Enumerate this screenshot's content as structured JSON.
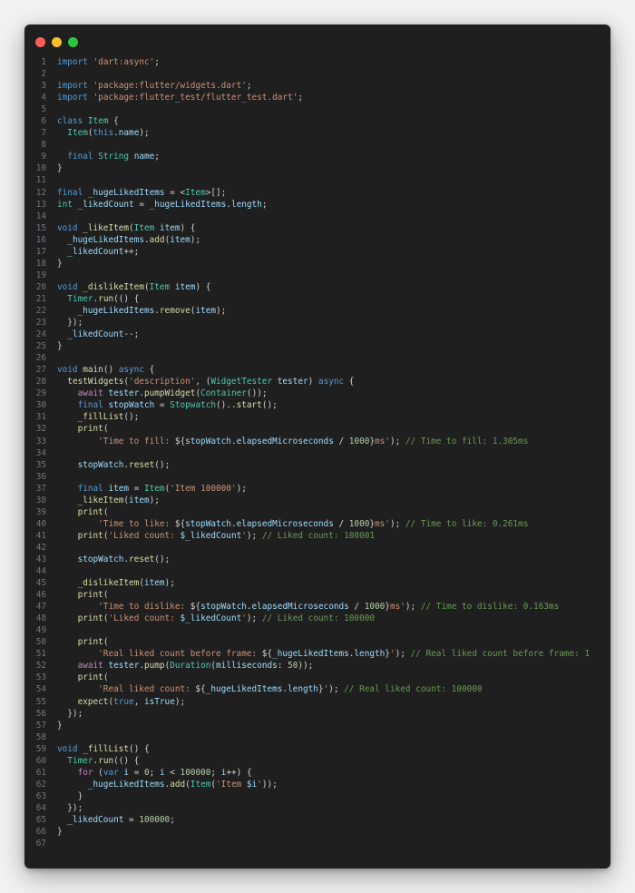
{
  "window": {
    "controls": [
      "close",
      "minimize",
      "maximize"
    ]
  },
  "editor": {
    "language": "dart",
    "lines": [
      [
        [
          "kw",
          "import"
        ],
        [
          "p",
          " "
        ],
        [
          "str",
          "'dart:async'"
        ],
        [
          "p",
          ";"
        ]
      ],
      [],
      [
        [
          "kw",
          "import"
        ],
        [
          "p",
          " "
        ],
        [
          "str",
          "'package:flutter/widgets.dart'"
        ],
        [
          "p",
          ";"
        ]
      ],
      [
        [
          "kw",
          "import"
        ],
        [
          "p",
          " "
        ],
        [
          "str",
          "'package:flutter_test/flutter_test.dart'"
        ],
        [
          "p",
          ";"
        ]
      ],
      [],
      [
        [
          "kw",
          "class"
        ],
        [
          "p",
          " "
        ],
        [
          "ty",
          "Item"
        ],
        [
          "p",
          " {"
        ]
      ],
      [
        [
          "p",
          "  "
        ],
        [
          "ty",
          "Item"
        ],
        [
          "p",
          "("
        ],
        [
          "kw",
          "this"
        ],
        [
          "p",
          "."
        ],
        [
          "var",
          "name"
        ],
        [
          "p",
          ");"
        ]
      ],
      [],
      [
        [
          "p",
          "  "
        ],
        [
          "kw",
          "final"
        ],
        [
          "p",
          " "
        ],
        [
          "ty",
          "String"
        ],
        [
          "p",
          " "
        ],
        [
          "var",
          "name"
        ],
        [
          "p",
          ";"
        ]
      ],
      [
        [
          "p",
          "}"
        ]
      ],
      [],
      [
        [
          "kw",
          "final"
        ],
        [
          "p",
          " "
        ],
        [
          "var",
          "_hugeLikedItems"
        ],
        [
          "p",
          " = <"
        ],
        [
          "ty",
          "Item"
        ],
        [
          "p",
          ">[];"
        ]
      ],
      [
        [
          "ty",
          "int"
        ],
        [
          "p",
          " "
        ],
        [
          "var",
          "_likedCount"
        ],
        [
          "p",
          " = "
        ],
        [
          "var",
          "_hugeLikedItems"
        ],
        [
          "p",
          "."
        ],
        [
          "var",
          "length"
        ],
        [
          "p",
          ";"
        ]
      ],
      [],
      [
        [
          "kw",
          "void"
        ],
        [
          "p",
          " "
        ],
        [
          "fn",
          "_likeItem"
        ],
        [
          "p",
          "("
        ],
        [
          "ty",
          "Item"
        ],
        [
          "p",
          " "
        ],
        [
          "var",
          "item"
        ],
        [
          "p",
          ") {"
        ]
      ],
      [
        [
          "p",
          "  "
        ],
        [
          "var",
          "_hugeLikedItems"
        ],
        [
          "p",
          "."
        ],
        [
          "fn",
          "add"
        ],
        [
          "p",
          "("
        ],
        [
          "var",
          "item"
        ],
        [
          "p",
          ");"
        ]
      ],
      [
        [
          "p",
          "  "
        ],
        [
          "var",
          "_likedCount"
        ],
        [
          "p",
          "++;"
        ]
      ],
      [
        [
          "p",
          "}"
        ]
      ],
      [],
      [
        [
          "kw",
          "void"
        ],
        [
          "p",
          " "
        ],
        [
          "fn",
          "_dislikeItem"
        ],
        [
          "p",
          "("
        ],
        [
          "ty",
          "Item"
        ],
        [
          "p",
          " "
        ],
        [
          "var",
          "item"
        ],
        [
          "p",
          ") {"
        ]
      ],
      [
        [
          "p",
          "  "
        ],
        [
          "ty",
          "Timer"
        ],
        [
          "p",
          "."
        ],
        [
          "fn",
          "run"
        ],
        [
          "p",
          "(() {"
        ]
      ],
      [
        [
          "p",
          "    "
        ],
        [
          "var",
          "_hugeLikedItems"
        ],
        [
          "p",
          "."
        ],
        [
          "fn",
          "remove"
        ],
        [
          "p",
          "("
        ],
        [
          "var",
          "item"
        ],
        [
          "p",
          ");"
        ]
      ],
      [
        [
          "p",
          "  });"
        ]
      ],
      [
        [
          "p",
          "  "
        ],
        [
          "var",
          "_likedCount"
        ],
        [
          "p",
          "--;"
        ]
      ],
      [
        [
          "p",
          "}"
        ]
      ],
      [],
      [
        [
          "kw",
          "void"
        ],
        [
          "p",
          " "
        ],
        [
          "fn",
          "main"
        ],
        [
          "p",
          "() "
        ],
        [
          "kw",
          "async"
        ],
        [
          "p",
          " {"
        ]
      ],
      [
        [
          "p",
          "  "
        ],
        [
          "fn",
          "testWidgets"
        ],
        [
          "p",
          "("
        ],
        [
          "str",
          "'description'"
        ],
        [
          "p",
          ", ("
        ],
        [
          "ty",
          "WidgetTester"
        ],
        [
          "p",
          " "
        ],
        [
          "var",
          "tester"
        ],
        [
          "p",
          ") "
        ],
        [
          "kw",
          "async"
        ],
        [
          "p",
          " {"
        ]
      ],
      [
        [
          "p",
          "    "
        ],
        [
          "ctl",
          "await"
        ],
        [
          "p",
          " "
        ],
        [
          "var",
          "tester"
        ],
        [
          "p",
          "."
        ],
        [
          "fn",
          "pumpWidget"
        ],
        [
          "p",
          "("
        ],
        [
          "ty",
          "Container"
        ],
        [
          "p",
          "());"
        ]
      ],
      [
        [
          "p",
          "    "
        ],
        [
          "kw",
          "final"
        ],
        [
          "p",
          " "
        ],
        [
          "var",
          "stopWatch"
        ],
        [
          "p",
          " = "
        ],
        [
          "ty",
          "Stopwatch"
        ],
        [
          "p",
          "().."
        ],
        [
          "fn",
          "start"
        ],
        [
          "p",
          "();"
        ]
      ],
      [
        [
          "p",
          "    "
        ],
        [
          "fn",
          "_fillList"
        ],
        [
          "p",
          "();"
        ]
      ],
      [
        [
          "p",
          "    "
        ],
        [
          "fn",
          "print"
        ],
        [
          "p",
          "("
        ]
      ],
      [
        [
          "p",
          "        "
        ],
        [
          "str",
          "'Time to fill: "
        ],
        [
          "p",
          "${"
        ],
        [
          "var",
          "stopWatch"
        ],
        [
          "p",
          "."
        ],
        [
          "var",
          "elapsedMicroseconds"
        ],
        [
          "p",
          " / "
        ],
        [
          "num",
          "1000"
        ],
        [
          "p",
          "}"
        ],
        [
          "str",
          "ms'"
        ],
        [
          "p",
          "); "
        ],
        [
          "com",
          "// Time to fill: 1.305ms"
        ]
      ],
      [],
      [
        [
          "p",
          "    "
        ],
        [
          "var",
          "stopWatch"
        ],
        [
          "p",
          "."
        ],
        [
          "fn",
          "reset"
        ],
        [
          "p",
          "();"
        ]
      ],
      [],
      [
        [
          "p",
          "    "
        ],
        [
          "kw",
          "final"
        ],
        [
          "p",
          " "
        ],
        [
          "var",
          "item"
        ],
        [
          "p",
          " = "
        ],
        [
          "ty",
          "Item"
        ],
        [
          "p",
          "("
        ],
        [
          "str",
          "'Item 100000'"
        ],
        [
          "p",
          ");"
        ]
      ],
      [
        [
          "p",
          "    "
        ],
        [
          "fn",
          "_likeItem"
        ],
        [
          "p",
          "("
        ],
        [
          "var",
          "item"
        ],
        [
          "p",
          ");"
        ]
      ],
      [
        [
          "p",
          "    "
        ],
        [
          "fn",
          "print"
        ],
        [
          "p",
          "("
        ]
      ],
      [
        [
          "p",
          "        "
        ],
        [
          "str",
          "'Time to like: "
        ],
        [
          "p",
          "${"
        ],
        [
          "var",
          "stopWatch"
        ],
        [
          "p",
          "."
        ],
        [
          "var",
          "elapsedMicroseconds"
        ],
        [
          "p",
          " / "
        ],
        [
          "num",
          "1000"
        ],
        [
          "p",
          "}"
        ],
        [
          "str",
          "ms'"
        ],
        [
          "p",
          "); "
        ],
        [
          "com",
          "// Time to like: 0.261ms"
        ]
      ],
      [
        [
          "p",
          "    "
        ],
        [
          "fn",
          "print"
        ],
        [
          "p",
          "("
        ],
        [
          "str",
          "'Liked count: "
        ],
        [
          "var",
          "$_likedCount"
        ],
        [
          "str",
          "'"
        ],
        [
          "p",
          "); "
        ],
        [
          "com",
          "// Liked count: 100001"
        ]
      ],
      [],
      [
        [
          "p",
          "    "
        ],
        [
          "var",
          "stopWatch"
        ],
        [
          "p",
          "."
        ],
        [
          "fn",
          "reset"
        ],
        [
          "p",
          "();"
        ]
      ],
      [],
      [
        [
          "p",
          "    "
        ],
        [
          "fn",
          "_dislikeItem"
        ],
        [
          "p",
          "("
        ],
        [
          "var",
          "item"
        ],
        [
          "p",
          ");"
        ]
      ],
      [
        [
          "p",
          "    "
        ],
        [
          "fn",
          "print"
        ],
        [
          "p",
          "("
        ]
      ],
      [
        [
          "p",
          "        "
        ],
        [
          "str",
          "'Time to dislike: "
        ],
        [
          "p",
          "${"
        ],
        [
          "var",
          "stopWatch"
        ],
        [
          "p",
          "."
        ],
        [
          "var",
          "elapsedMicroseconds"
        ],
        [
          "p",
          " / "
        ],
        [
          "num",
          "1000"
        ],
        [
          "p",
          "}"
        ],
        [
          "str",
          "ms'"
        ],
        [
          "p",
          "); "
        ],
        [
          "com",
          "// Time to dislike: 0.163ms"
        ]
      ],
      [
        [
          "p",
          "    "
        ],
        [
          "fn",
          "print"
        ],
        [
          "p",
          "("
        ],
        [
          "str",
          "'Liked count: "
        ],
        [
          "var",
          "$_likedCount"
        ],
        [
          "str",
          "'"
        ],
        [
          "p",
          "); "
        ],
        [
          "com",
          "// Liked count: 100000"
        ]
      ],
      [],
      [
        [
          "p",
          "    "
        ],
        [
          "fn",
          "print"
        ],
        [
          "p",
          "("
        ]
      ],
      [
        [
          "p",
          "        "
        ],
        [
          "str",
          "'Real liked count before frame: "
        ],
        [
          "p",
          "${"
        ],
        [
          "var",
          "_hugeLikedItems"
        ],
        [
          "p",
          "."
        ],
        [
          "var",
          "length"
        ],
        [
          "p",
          "}"
        ],
        [
          "str",
          "'"
        ],
        [
          "p",
          "); "
        ],
        [
          "com",
          "// Real liked count before frame: 1"
        ]
      ],
      [
        [
          "p",
          "    "
        ],
        [
          "ctl",
          "await"
        ],
        [
          "p",
          " "
        ],
        [
          "var",
          "tester"
        ],
        [
          "p",
          "."
        ],
        [
          "fn",
          "pump"
        ],
        [
          "p",
          "("
        ],
        [
          "ty",
          "Duration"
        ],
        [
          "p",
          "("
        ],
        [
          "var",
          "milliseconds"
        ],
        [
          "p",
          ": "
        ],
        [
          "num",
          "50"
        ],
        [
          "p",
          "));"
        ]
      ],
      [
        [
          "p",
          "    "
        ],
        [
          "fn",
          "print"
        ],
        [
          "p",
          "("
        ]
      ],
      [
        [
          "p",
          "        "
        ],
        [
          "str",
          "'Real liked count: "
        ],
        [
          "p",
          "${"
        ],
        [
          "var",
          "_hugeLikedItems"
        ],
        [
          "p",
          "."
        ],
        [
          "var",
          "length"
        ],
        [
          "p",
          "}"
        ],
        [
          "str",
          "'"
        ],
        [
          "p",
          "); "
        ],
        [
          "com",
          "// Real liked count: 100000"
        ]
      ],
      [
        [
          "p",
          "    "
        ],
        [
          "fn",
          "expect"
        ],
        [
          "p",
          "("
        ],
        [
          "kw",
          "true"
        ],
        [
          "p",
          ", "
        ],
        [
          "var",
          "isTrue"
        ],
        [
          "p",
          ");"
        ]
      ],
      [
        [
          "p",
          "  });"
        ]
      ],
      [
        [
          "p",
          "}"
        ]
      ],
      [],
      [
        [
          "kw",
          "void"
        ],
        [
          "p",
          " "
        ],
        [
          "fn",
          "_fillList"
        ],
        [
          "p",
          "() {"
        ]
      ],
      [
        [
          "p",
          "  "
        ],
        [
          "ty",
          "Timer"
        ],
        [
          "p",
          "."
        ],
        [
          "fn",
          "run"
        ],
        [
          "p",
          "(() {"
        ]
      ],
      [
        [
          "p",
          "    "
        ],
        [
          "ctl",
          "for"
        ],
        [
          "p",
          " ("
        ],
        [
          "kw",
          "var"
        ],
        [
          "p",
          " "
        ],
        [
          "var",
          "i"
        ],
        [
          "p",
          " = "
        ],
        [
          "num",
          "0"
        ],
        [
          "p",
          "; "
        ],
        [
          "var",
          "i"
        ],
        [
          "p",
          " < "
        ],
        [
          "num",
          "100000"
        ],
        [
          "p",
          "; "
        ],
        [
          "var",
          "i"
        ],
        [
          "p",
          "++) {"
        ]
      ],
      [
        [
          "p",
          "      "
        ],
        [
          "var",
          "_hugeLikedItems"
        ],
        [
          "p",
          "."
        ],
        [
          "fn",
          "add"
        ],
        [
          "p",
          "("
        ],
        [
          "ty",
          "Item"
        ],
        [
          "p",
          "("
        ],
        [
          "str",
          "'Item "
        ],
        [
          "var",
          "$i"
        ],
        [
          "str",
          "'"
        ],
        [
          "p",
          "));"
        ]
      ],
      [
        [
          "p",
          "    }"
        ]
      ],
      [
        [
          "p",
          "  });"
        ]
      ],
      [
        [
          "p",
          "  "
        ],
        [
          "var",
          "_likedCount"
        ],
        [
          "p",
          " = "
        ],
        [
          "num",
          "100000"
        ],
        [
          "p",
          ";"
        ]
      ],
      [
        [
          "p",
          "}"
        ]
      ],
      []
    ]
  },
  "colors": {
    "background": "#1f1f1f",
    "close": "#ff5f57",
    "minimize": "#febc2e",
    "maximize": "#28c840"
  }
}
